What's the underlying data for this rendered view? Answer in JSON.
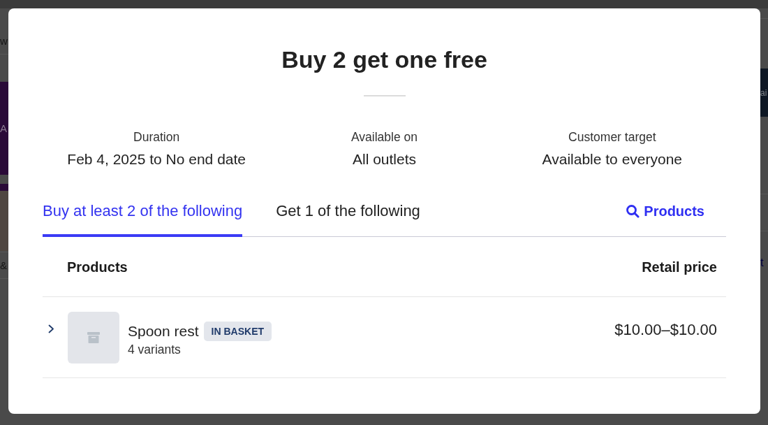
{
  "background": {
    "left": [
      {
        "kind": "row",
        "text": "w"
      },
      {
        "kind": "banner",
        "text": "A"
      },
      {
        "kind": "photo"
      },
      {
        "kind": "row",
        "text": "&"
      }
    ],
    "right": [
      {
        "kind": "banner",
        "text": "ai"
      },
      {
        "kind": "link",
        "text": "t"
      }
    ]
  },
  "dialog": {
    "title": "Buy 2 get one free",
    "details": [
      {
        "label": "Duration",
        "value": "Feb 4, 2025 to No end date"
      },
      {
        "label": "Available on",
        "value": "All outlets"
      },
      {
        "label": "Customer target",
        "value": "Available to everyone"
      }
    ],
    "tabs": [
      {
        "label": "Buy at least 2 of the following",
        "selected": true
      },
      {
        "label": "Get 1 of the following",
        "selected": false
      }
    ],
    "search_button": {
      "label": "Products"
    },
    "table": {
      "columns": [
        "Products",
        "Retail price"
      ],
      "rows": [
        {
          "expanded": false,
          "name": "Spoon rest",
          "badge": "IN BASKET",
          "variants": "4 variants",
          "price": "$10.00–$10.00"
        }
      ]
    }
  }
}
